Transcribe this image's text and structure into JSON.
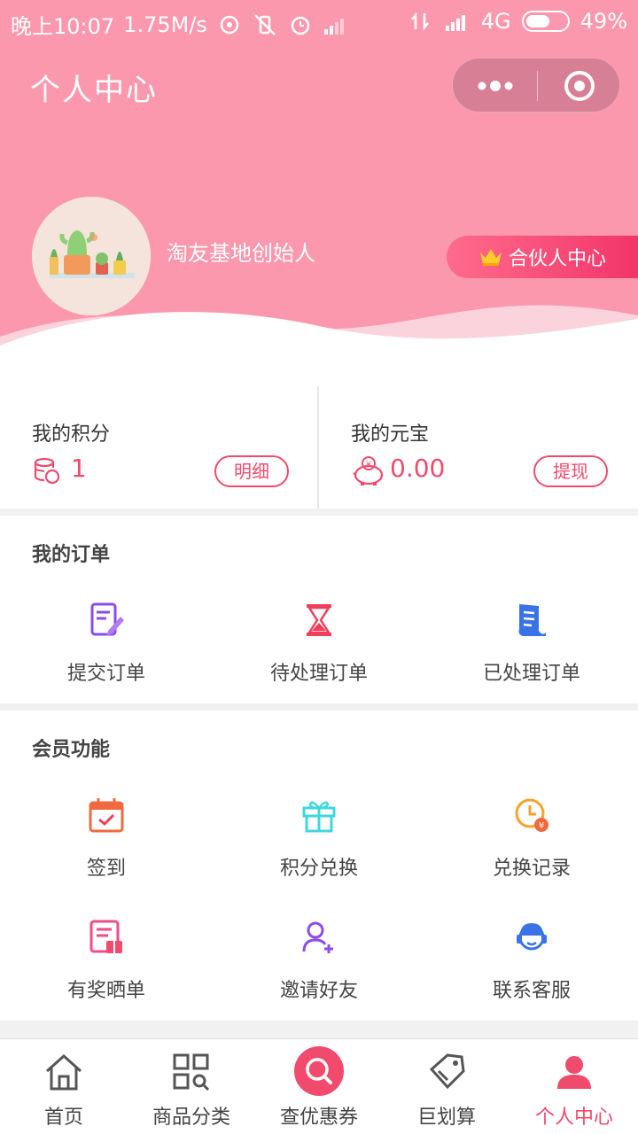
{
  "status_bar": {
    "time": "晚上10:07",
    "speed": "1.75M/s",
    "network": "4G",
    "battery": "49%"
  },
  "header": {
    "title": "个人中心",
    "username": "淘友基地创始人",
    "partner_button": "合伙人中心"
  },
  "stats": {
    "points": {
      "label": "我的积分",
      "value": "1",
      "button": "明细"
    },
    "yuanbao": {
      "label": "我的元宝",
      "value": "0.00",
      "button": "提现"
    }
  },
  "orders": {
    "title": "我的订单",
    "items": [
      {
        "label": "提交订单",
        "icon": "edit-document-icon"
      },
      {
        "label": "待处理订单",
        "icon": "hourglass-icon"
      },
      {
        "label": "已处理订单",
        "icon": "receipt-icon"
      }
    ]
  },
  "member": {
    "title": "会员功能",
    "items": [
      {
        "label": "签到",
        "icon": "calendar-check-icon"
      },
      {
        "label": "积分兑换",
        "icon": "gift-icon"
      },
      {
        "label": "兑换记录",
        "icon": "clock-yuan-icon"
      },
      {
        "label": "有奖晒单",
        "icon": "form-gift-icon"
      },
      {
        "label": "邀请好友",
        "icon": "add-user-icon"
      },
      {
        "label": "联系客服",
        "icon": "customer-service-icon"
      }
    ]
  },
  "tabbar": {
    "items": [
      {
        "label": "首页",
        "icon": "home-icon"
      },
      {
        "label": "商品分类",
        "icon": "category-icon"
      },
      {
        "label": "查优惠券",
        "icon": "search-icon"
      },
      {
        "label": "巨划算",
        "icon": "price-tag-icon"
      },
      {
        "label": "个人中心",
        "icon": "user-icon"
      }
    ],
    "active_index": 4
  },
  "colors": {
    "header_pink": "#fb98ae",
    "accent": "#f04a6d",
    "purple": "#8a4dea",
    "cyan": "#3fd7dc",
    "orange": "#f7a22a",
    "blue": "#3a73e8"
  }
}
